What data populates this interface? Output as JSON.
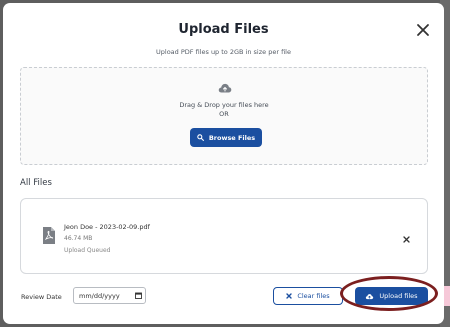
{
  "modal": {
    "title": "Upload Files",
    "subtitle": "Upload PDF files up to 2GB in size per file"
  },
  "dropzone": {
    "drag_text": "Drag & Drop your files here",
    "or_text": "OR",
    "browse_label": "Browse Files"
  },
  "files_section": {
    "title": "All Files",
    "files": [
      {
        "name": "Jeon Doe - 2023-02-09.pdf",
        "size": "46.74 MB",
        "status": "Upload Queued"
      }
    ]
  },
  "footer": {
    "review_date_label": "Review Date",
    "review_date_value": "mm/dd/yyyy",
    "clear_label": "Clear files",
    "upload_label": "Upload files"
  },
  "colors": {
    "primary": "#1b4fa0",
    "highlight_ring": "#7b1f1f"
  }
}
